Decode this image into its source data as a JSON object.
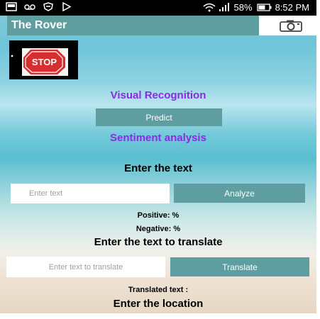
{
  "status_bar": {
    "battery": "58%",
    "time": "8:52 PM"
  },
  "app": {
    "title": "The Rover",
    "camera_icon": "camera-icon"
  },
  "image": {
    "stop_sign_text": "STOP"
  },
  "visual_recognition": {
    "heading": "Visual Recognition",
    "predict_label": "Predict"
  },
  "sentiment": {
    "heading": "Sentiment analysis",
    "prompt": "Enter the text",
    "input_placeholder": "Enter text",
    "analyze_label": "Analyze",
    "positive": "Positive: %",
    "negative": "Negative: %"
  },
  "translate": {
    "prompt": "Enter the text to translate",
    "input_placeholder": "Enter text to translate",
    "translate_label": "Translate",
    "translated_text": "Translated text :"
  },
  "location": {
    "prompt": "Enter the location"
  },
  "colors": {
    "accent": "#5f9ea0",
    "heading_purple": "#8a2be2"
  }
}
